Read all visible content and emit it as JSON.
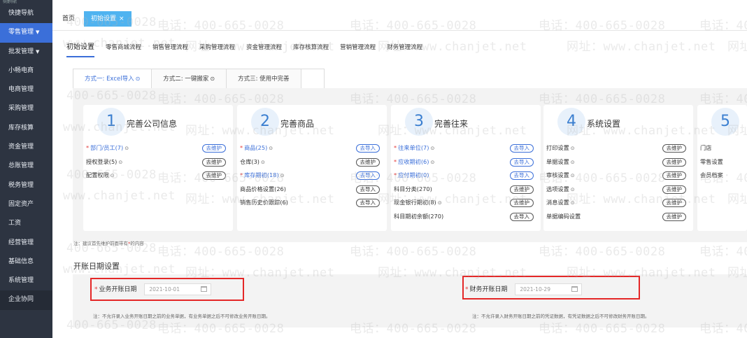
{
  "sidebar": {
    "top_strip": "快捷导航",
    "items": [
      {
        "label": "快捷导航",
        "active": false,
        "caret": ""
      },
      {
        "label": "零售管理",
        "active": true,
        "caret": "▼"
      },
      {
        "label": "批发管理",
        "active": false,
        "caret": "▼"
      },
      {
        "label": "小畅电商",
        "active": false,
        "caret": ""
      },
      {
        "label": "电商管理",
        "active": false,
        "caret": ""
      },
      {
        "label": "采购管理",
        "active": false,
        "caret": ""
      },
      {
        "label": "库存核算",
        "active": false,
        "caret": ""
      },
      {
        "label": "资金管理",
        "active": false,
        "caret": ""
      },
      {
        "label": "总账管理",
        "active": false,
        "caret": ""
      },
      {
        "label": "税务管理",
        "active": false,
        "caret": ""
      },
      {
        "label": "固定资产",
        "active": false,
        "caret": ""
      },
      {
        "label": "工资",
        "active": false,
        "caret": ""
      },
      {
        "label": "经营管理",
        "active": false,
        "caret": ""
      },
      {
        "label": "基础信息",
        "active": false,
        "caret": ""
      },
      {
        "label": "系统管理",
        "active": false,
        "caret": ""
      },
      {
        "label": "企业协同",
        "active": false,
        "caret": ""
      }
    ]
  },
  "tabbar": {
    "home": "首页",
    "active_tab": "初始设置",
    "close": "×"
  },
  "flow_tabs": [
    "初始设置",
    "零售商城流程",
    "销售管理流程",
    "采购管理流程",
    "资金管理流程",
    "库存核算流程",
    "营销管理流程",
    "财务管理流程"
  ],
  "methods": [
    {
      "label": "方式一: Excel导入",
      "icon": "⊙"
    },
    {
      "label": "方式二: 一键搬家",
      "icon": "⊙"
    },
    {
      "label": "方式三: 使用中完善",
      "icon": ""
    }
  ],
  "cards": [
    {
      "num": "1",
      "title": "完善公司信息",
      "rows": [
        {
          "req": true,
          "label": "部门/员工(7)",
          "blue": true,
          "icon": "⊙",
          "btn": "去维护",
          "btn_blue": true
        },
        {
          "req": false,
          "label": "授权登录(5)",
          "blue": false,
          "icon": "⊙",
          "btn": "去维护",
          "btn_blue": false
        },
        {
          "req": false,
          "label": "配置权限",
          "blue": false,
          "icon": "⊙",
          "btn": "去维护",
          "btn_blue": false
        }
      ]
    },
    {
      "num": "2",
      "title": "完善商品",
      "rows": [
        {
          "req": true,
          "label": "商品(25)",
          "blue": true,
          "icon": "⊙",
          "btn": "去导入",
          "btn_blue": true
        },
        {
          "req": false,
          "label": "仓库(3)",
          "blue": false,
          "icon": "⊙",
          "btn": "去维护",
          "btn_blue": false
        },
        {
          "req": true,
          "label": "库存期初(18)",
          "blue": true,
          "icon": "⊙",
          "btn": "去导入",
          "btn_blue": true
        },
        {
          "req": false,
          "label": "商品价格设置(26)",
          "blue": false,
          "icon": "",
          "btn": "去导入",
          "btn_blue": false
        },
        {
          "req": false,
          "label": "销售历史价跟踪(6)",
          "blue": false,
          "icon": "",
          "btn": "去导入",
          "btn_blue": false
        }
      ]
    },
    {
      "num": "3",
      "title": "完善往来",
      "rows": [
        {
          "req": true,
          "label": "往来单位(7)",
          "blue": true,
          "icon": "⊙",
          "btn": "去导入",
          "btn_blue": true
        },
        {
          "req": true,
          "label": "应收期初(6)",
          "blue": true,
          "icon": "⊙",
          "btn": "去导入",
          "btn_blue": true
        },
        {
          "req": true,
          "label": "应付期初(0)",
          "blue": true,
          "icon": "",
          "btn": "去导入",
          "btn_blue": true
        },
        {
          "req": false,
          "label": "科目分类(270)",
          "blue": false,
          "icon": "",
          "btn": "去维护",
          "btn_blue": false
        },
        {
          "req": false,
          "label": "现金银行期初(8)",
          "blue": false,
          "icon": "⊙",
          "btn": "去维护",
          "btn_blue": false
        },
        {
          "req": false,
          "label": "科目期初余额(270)",
          "blue": false,
          "icon": "",
          "btn": "去导入",
          "btn_blue": false
        }
      ]
    },
    {
      "num": "4",
      "title": "系统设置",
      "rows": [
        {
          "req": false,
          "label": "打印设置",
          "blue": false,
          "icon": "⊙",
          "btn": "去维护",
          "btn_blue": false
        },
        {
          "req": false,
          "label": "单据设置",
          "blue": false,
          "icon": "⊙",
          "btn": "去维护",
          "btn_blue": false
        },
        {
          "req": false,
          "label": "审核设置",
          "blue": false,
          "icon": "⊙",
          "btn": "去维护",
          "btn_blue": false
        },
        {
          "req": false,
          "label": "选项设置",
          "blue": false,
          "icon": "⊙",
          "btn": "去维护",
          "btn_blue": false
        },
        {
          "req": false,
          "label": "消息设置",
          "blue": false,
          "icon": "⊙",
          "btn": "去维护",
          "btn_blue": false
        },
        {
          "req": false,
          "label": "单据编码设置",
          "blue": false,
          "icon": "",
          "btn": "去维护",
          "btn_blue": false
        }
      ]
    },
    {
      "num": "5",
      "title": "",
      "rows": [
        {
          "req": false,
          "label": "门店",
          "blue": false,
          "icon": "",
          "btn": "",
          "btn_blue": false
        },
        {
          "req": false,
          "label": "零售设置",
          "blue": false,
          "icon": "",
          "btn": "",
          "btn_blue": false
        },
        {
          "req": false,
          "label": "会员档案",
          "blue": false,
          "icon": "",
          "btn": "",
          "btn_blue": false
        }
      ]
    }
  ],
  "note_required": {
    "prefix": "注：建议首先维护前面带有",
    "star": "*",
    "suffix": "的内容"
  },
  "open_date": {
    "section_title": "开账日期设置",
    "business": {
      "label": "业务开账日期",
      "value": "2021-10-01",
      "note": "注：不允许录入业务开账日期之前的业务单据，有业务单据之后不可修改业务开账日期。"
    },
    "finance": {
      "label": "财务开账日期",
      "value": "2021-10-29",
      "note": "注：不允许录入财务开账日期之前的凭证数据，有凭证数据之后不可修改财务开账日期。"
    }
  },
  "watermark": {
    "phone": "电话：400-665-0028",
    "phone_short": "400-665-0028",
    "site": "网址：www.chanjet.net",
    "site_short": "www.chanjet.net"
  },
  "colors": {
    "sidebar": "#2d3441",
    "active": "#3b6fd9",
    "tab_active": "#4fb3f0",
    "required": "#e23a3a",
    "highlight": "#e42727"
  }
}
